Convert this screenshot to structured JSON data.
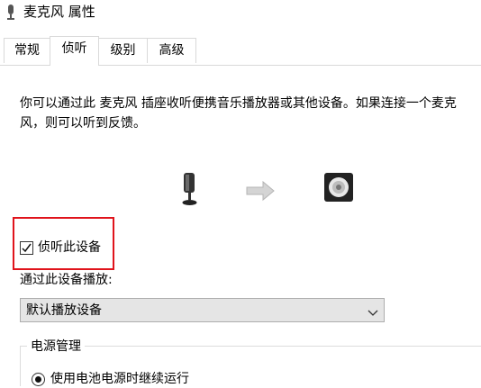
{
  "window": {
    "title": "麦克风 属性",
    "title_icon": "microphone-icon"
  },
  "tabs": [
    {
      "label": "常规",
      "active": false
    },
    {
      "label": "侦听",
      "active": true
    },
    {
      "label": "级别",
      "active": false
    },
    {
      "label": "高级",
      "active": false
    }
  ],
  "listen": {
    "description": "你可以通过此 麦克风 插座收听便携音乐播放器或其他设备。如果连接一个麦克\n风，则可以听到反馈。",
    "flow_icons": [
      "microphone-icon",
      "arrow-right-icon",
      "speaker-icon"
    ],
    "listen_checkbox": {
      "label": "侦听此设备",
      "checked": true
    },
    "highlight_color": "#e0141c",
    "playback_label": "通过此设备播放:",
    "playback_select": {
      "value": "默认播放设备"
    },
    "power_group": {
      "label": "电源管理",
      "options": [
        {
          "label": "使用电池电源时继续运行",
          "selected": true
        }
      ]
    }
  }
}
